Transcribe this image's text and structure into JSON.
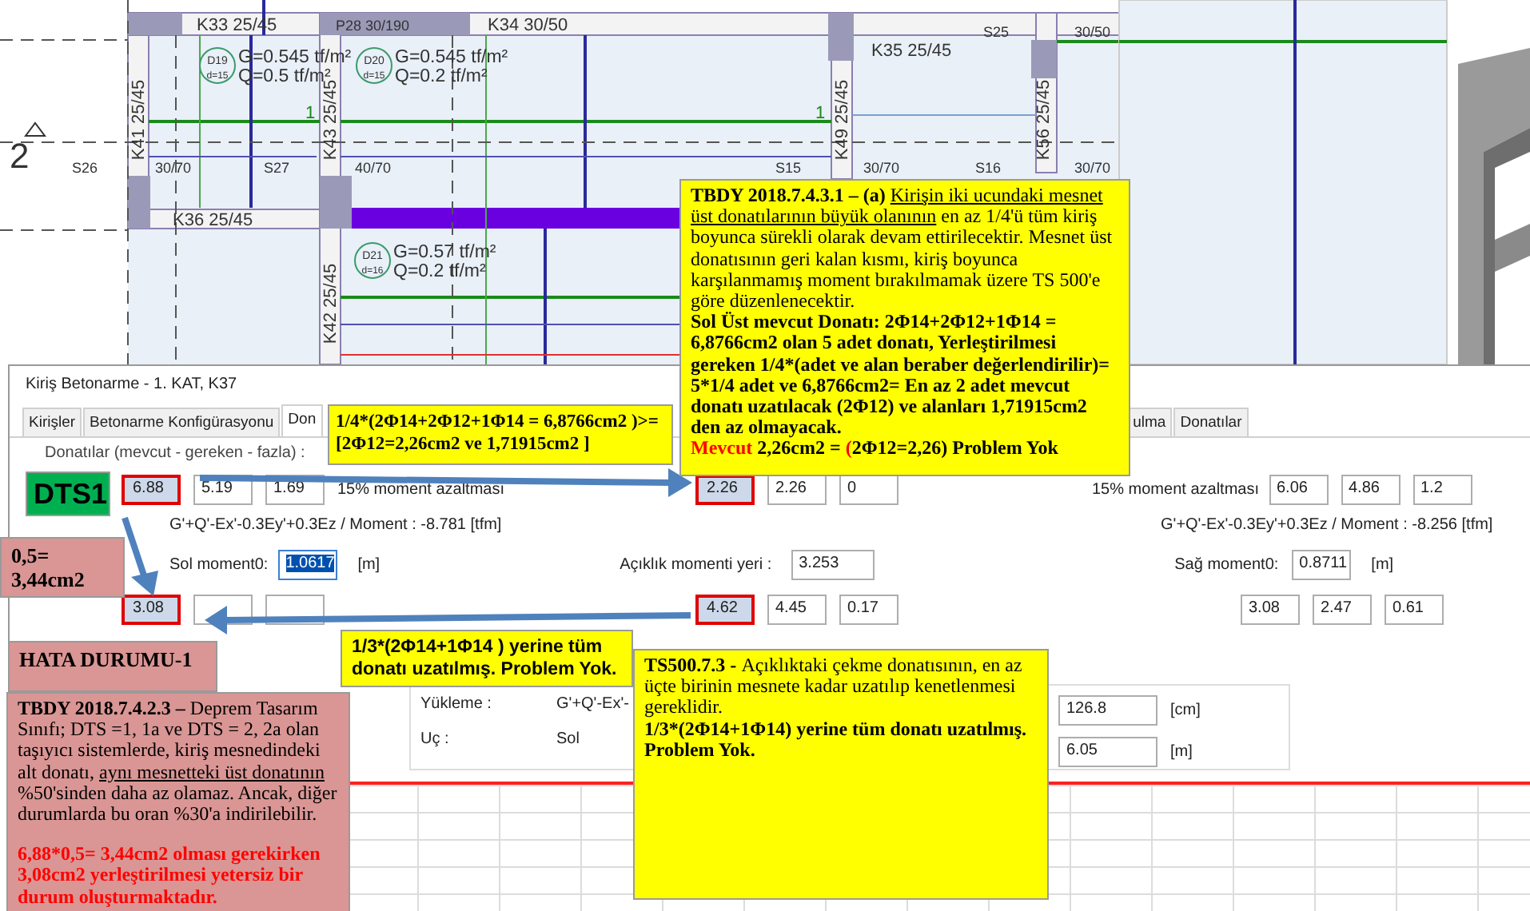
{
  "plan": {
    "labels": [
      {
        "text": "K33 25/45",
        "kind": "beam"
      },
      {
        "text": "P28 30/190",
        "kind": "column"
      },
      {
        "text": "K34 30/50",
        "kind": "beam"
      },
      {
        "text": "K35 25/45",
        "kind": "beam"
      },
      {
        "text": "K41 25/45",
        "kind": "beam"
      },
      {
        "text": "K43 25/45",
        "kind": "beam"
      },
      {
        "text": "K49 25/45",
        "kind": "beam"
      },
      {
        "text": "K56 25/45",
        "kind": "beam"
      },
      {
        "text": "K36 25/45",
        "kind": "beam"
      },
      {
        "text": "K42 25/45",
        "kind": "beam"
      },
      {
        "text": "S26",
        "kind": "column"
      },
      {
        "text": "S27",
        "kind": "column"
      },
      {
        "text": "S15",
        "kind": "column"
      },
      {
        "text": "S16",
        "kind": "column"
      },
      {
        "text": "S25",
        "kind": "column"
      },
      {
        "text": "30/70",
        "kind": "dimension"
      },
      {
        "text": "40/70",
        "kind": "dimension"
      },
      {
        "text": "30/70",
        "kind": "dimension"
      },
      {
        "text": "30/70",
        "kind": "dimension"
      },
      {
        "text": "30/50",
        "kind": "dimension"
      },
      {
        "text": "2",
        "kind": "axis"
      },
      {
        "text": "1",
        "kind": "span"
      },
      {
        "text": "1",
        "kind": "span"
      }
    ],
    "slabs": [
      {
        "id": "D19",
        "thickness": "d=15",
        "g": "G=0.545 tf/m²",
        "q": "Q=0.5 tf/m²"
      },
      {
        "id": "D20",
        "thickness": "d=15",
        "g": "G=0.545 tf/m²",
        "q": "Q=0.2 tf/m²"
      },
      {
        "id": "D21",
        "thickness": "d=16",
        "g": "G=0.57 tf/m²",
        "q": "Q=0.2 tf/m²"
      }
    ]
  },
  "dialog": {
    "title": "Kiriş Betonarme - 1. KAT, K37",
    "tabs": [
      {
        "label": "Kirişler",
        "selected": false
      },
      {
        "label": "Betonarme Konfigürasyonu",
        "selected": false
      },
      {
        "label": "Don",
        "selected": true
      },
      {
        "label": "ulma",
        "selected": false
      },
      {
        "label": "Donatılar",
        "selected": false
      }
    ],
    "group_label": "Donatılar (mevcut - gereken - fazla) :",
    "top_rebar": {
      "left": [
        {
          "value": "6.88",
          "highlighted": true
        },
        {
          "value": "5.19",
          "highlighted": false
        },
        {
          "value": "1.69",
          "highlighted": false
        }
      ],
      "left_note": "15% moment azaltması",
      "middle": [
        {
          "value": "2.26",
          "highlighted": true
        },
        {
          "value": "2.26",
          "highlighted": false
        },
        {
          "value": "0",
          "highlighted": false
        }
      ],
      "right_label": "15% moment azaltması",
      "right": [
        {
          "value": "6.06",
          "highlighted": false
        },
        {
          "value": "4.86",
          "highlighted": false
        },
        {
          "value": "1.2",
          "highlighted": false
        }
      ]
    },
    "moments": [
      "G'+Q'-Ex'-0.3Ey'+0.3Ez  / Moment : -8.781 [tfm]",
      "G'+Q'-Ex'-0.3Ey'+0.3Ez  / Moment : -8.256 [tfm]"
    ],
    "positions": [
      {
        "label": "Sol moment0:",
        "value": "1.0617",
        "unit": "[m]",
        "focused": true
      },
      {
        "label": "Açıklık momenti yeri :",
        "value": "3.253",
        "focused": false
      },
      {
        "label": "Sağ moment0:",
        "value": "0.8711",
        "unit": "[m]",
        "focused": false
      }
    ],
    "bottom_rebar": {
      "left": [
        {
          "value": "3.08",
          "highlighted": true
        },
        {
          "highlighted": false
        },
        {
          "highlighted": false
        }
      ],
      "middle": [
        {
          "value": "4.62",
          "highlighted": true
        },
        {
          "value": "4.45",
          "highlighted": false
        },
        {
          "value": "0.17",
          "highlighted": false
        }
      ],
      "right": [
        {
          "value": "3.08",
          "highlighted": false
        },
        {
          "value": "2.47",
          "highlighted": false
        },
        {
          "value": "0.61",
          "highlighted": false
        }
      ]
    },
    "loading": [
      {
        "label": "Yükleme :",
        "value": "G'+Q'-Ex'-"
      },
      {
        "label": "Uç :",
        "value": "Sol"
      }
    ],
    "lengths": [
      {
        "value": "126.8",
        "unit": "[cm]"
      },
      {
        "value": "6.05",
        "unit": "[m]"
      }
    ]
  },
  "callouts": [
    {
      "kind": "yellow",
      "paragraphs": [
        [
          {
            "text": "1/4*(2Φ14+2Φ12+1Φ14 = 6,8766cm2 )>= [2Φ12=2,26cm2 ve 1,71915cm2 ]",
            "kind": "emphasis"
          }
        ]
      ]
    },
    {
      "kind": "yellow",
      "paragraphs": [
        [
          {
            "text": "TBDY 2018.7.4.3.1 – (a) ",
            "kind": "heading"
          },
          {
            "text": "Kirişin iki ucundaki mesnet üst donatılarının büyük olanının",
            "kind": "underlined"
          },
          {
            "text": " en az 1/4'ü tüm kiriş boyunca sürekli olarak devam ettirilecektir. Mesnet üst donatısının geri kalan kısmı, kiriş boyunca karşılanmamış moment bırakılmamak üzere TS 500'e göre düzenlenecektir.",
            "kind": "body"
          }
        ],
        [
          {
            "text": "Sol Üst mevcut Donatı: 2Φ14+2Φ12+1Φ14 = 6,8766cm2 olan 5 adet donatı, Yerleştirilmesi gereken 1/4*(adet ve alan beraber değerlendirilir)= 5*1/4 adet ve 6,8766cm2= En az 2 adet mevcut donatı uzatılacak (2Φ12) ve alanları 1,71915cm2 den az olmayacak.",
            "kind": "emphasis"
          }
        ],
        [
          {
            "text": "Mevcut",
            "kind": "warning"
          },
          {
            "text": " 2,26cm2 = ",
            "kind": "emphasis"
          },
          {
            "text": "(",
            "kind": "warning"
          },
          {
            "text": "2Φ12=2,26) Problem Yok",
            "kind": "emphasis"
          }
        ]
      ]
    },
    {
      "kind": "green",
      "paragraphs": [
        [
          {
            "text": "DTS1",
            "kind": "emphasis"
          }
        ]
      ]
    },
    {
      "kind": "pink",
      "paragraphs": [
        [
          {
            "text": "0,5= 3,44cm2",
            "kind": "emphasis"
          }
        ]
      ]
    },
    {
      "kind": "pink",
      "paragraphs": [
        [
          {
            "text": "HATA DURUMU-1",
            "kind": "emphasis"
          }
        ]
      ]
    },
    {
      "kind": "yellow",
      "paragraphs": [
        [
          {
            "text": "1/3*(2Φ14+1Φ14 ) yerine tüm donatı uzatılmış. Problem Yok.",
            "kind": "emphasis"
          }
        ]
      ]
    },
    {
      "kind": "pink",
      "paragraphs": [
        [
          {
            "text": "TBDY 2018.7.4.2.3 – ",
            "kind": "heading"
          },
          {
            "text": "Deprem Tasarım Sınıfı; DTS =1, 1a ve DTS = 2, 2a olan taşıyıcı sistemlerde, kiriş mesnedindeki alt donatı, ",
            "kind": "body"
          },
          {
            "text": "aynı mesnetteki üst donatının",
            "kind": "underlined"
          },
          {
            "text": " %50'sinden daha az olamaz. Ancak, diğer durumlarda bu oran %30'a indirilebilir.",
            "kind": "body"
          }
        ],
        [
          {
            "text": "6,88*0,5= 3,44cm2 olması gerekirken 3,08cm2 yerleştirilmesi yetersiz bir durum oluşturmaktadır.",
            "kind": "warning"
          }
        ]
      ]
    },
    {
      "kind": "yellow",
      "paragraphs": [
        [
          {
            "text": "TS500.7.3 - ",
            "kind": "heading"
          },
          {
            "text": "Açıklıktaki çekme donatısının, en az üçte birinin mesnete kadar uzatılıp kenetlenmesi gereklidir.",
            "kind": "body"
          }
        ],
        [
          {
            "text": "1/3*(2Φ14+1Φ14) yerine tüm donatı uzatılmış. Problem Yok.",
            "kind": "emphasis"
          }
        ]
      ]
    }
  ]
}
